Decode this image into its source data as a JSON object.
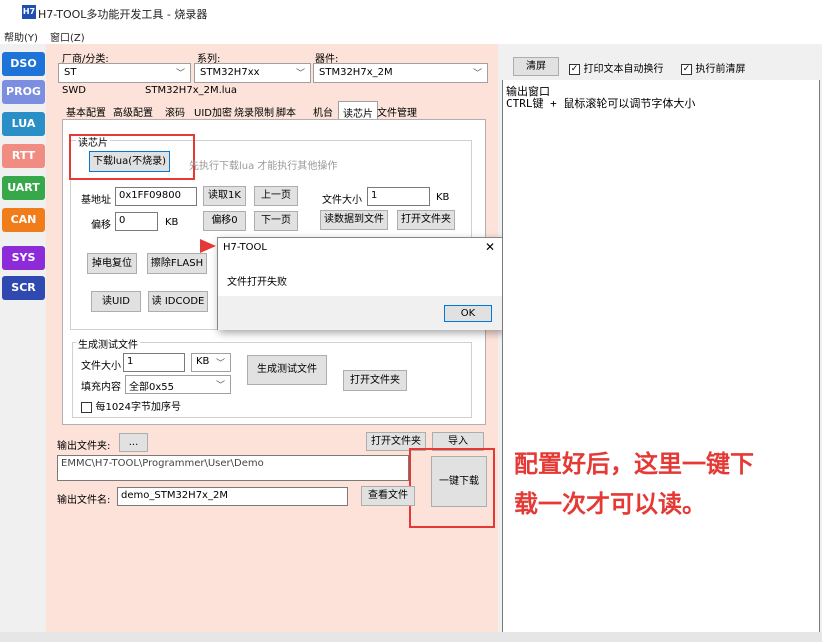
{
  "window": {
    "title": "H7-TOOL多功能开发工具 - 烧录器",
    "icon_text": "H7"
  },
  "menu": {
    "help": "帮助(Y)",
    "window": "窗口(Z)"
  },
  "sidebar": {
    "items": [
      {
        "label": "DSO",
        "color": "#1e73d8"
      },
      {
        "label": "PROG",
        "color": "#7c8ee0"
      },
      {
        "label": "LUA",
        "color": "#2a8fc7"
      },
      {
        "label": "RTT",
        "color": "#f08c82"
      },
      {
        "label": "UART",
        "color": "#37a84a"
      },
      {
        "label": "CAN",
        "color": "#f07d1a"
      },
      {
        "label": "SYS",
        "color": "#8d2bd9"
      },
      {
        "label": "SCR",
        "color": "#2f49b0"
      }
    ]
  },
  "selectors": {
    "vendor_label": "厂商/分类:",
    "vendor_value": "ST",
    "series_label": "系列:",
    "series_value": "STM32H7xx",
    "device_label": "器件:",
    "device_value": "STM32H7x_2M",
    "interface": "SWD",
    "lua_file": "STM32H7x_2M.lua"
  },
  "tabs": [
    "基本配置",
    "高级配置",
    "滚码",
    "UID加密",
    "烧录限制",
    "脚本",
    "机台",
    "读芯片",
    "文件管理"
  ],
  "read_chip": {
    "group_title": "读芯片",
    "download_btn": "下载lua(不烧录)",
    "download_hint": "先执行下载lua 才能执行其他操作",
    "base_addr_label": "基地址",
    "base_addr_value": "0x1FF09800",
    "read1k_btn": "读取1K",
    "prev_page_btn": "上一页",
    "file_size_label": "文件大小",
    "file_size_value": "1",
    "kb1": "KB",
    "offset_label": "偏移",
    "offset_value": "0",
    "kb2": "KB",
    "offset0_btn": "偏移0",
    "next_page_btn": "下一页",
    "read_to_file_btn": "读数据到文件",
    "open_folder_btn": "打开文件夹",
    "power_reset_btn": "掉电复位",
    "erase_flash_btn": "擦除FLASH",
    "read_uid_btn": "读UID",
    "read_idcode_btn": "读 IDCODE"
  },
  "gen_test": {
    "group_title": "生成测试文件",
    "size_label": "文件大小",
    "size_value": "1",
    "size_unit": "KB",
    "fill_label": "填充内容",
    "fill_value": "全部0x55",
    "gen_btn": "生成测试文件",
    "open_folder_btn": "打开文件夹",
    "seq_checkbox": "每1024字节加序号"
  },
  "output": {
    "folder_label": "输出文件夹:",
    "browse_btn": "...",
    "open_folder_btn": "打开文件夹",
    "import_btn": "导入",
    "path_value": "EMMC\\H7-TOOL\\Programmer\\User\\Demo",
    "onekey_btn": "一键下载",
    "filename_label": "输出文件名:",
    "filename_value": "demo_STM32H7x_2M",
    "view_file_btn": "查看文件"
  },
  "dialog": {
    "title": "H7-TOOL",
    "close": "✕",
    "message": "文件打开失败",
    "ok": "OK"
  },
  "right": {
    "clear_btn": "清屏",
    "auto_wrap_label": "打印文本自动换行",
    "clear_before_label": "执行前清屏",
    "log_line1": "输出窗口",
    "log_line2": "CTRL键 + 鼠标滚轮可以调节字体大小"
  },
  "annotation": {
    "line1": "配置好后，这里一键下",
    "line2": "载一次才可以读。"
  }
}
